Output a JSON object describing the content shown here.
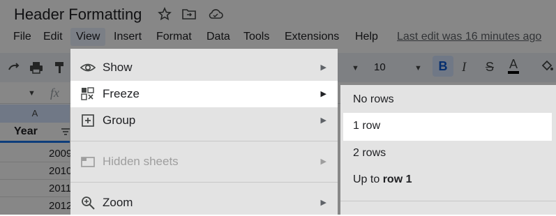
{
  "document": {
    "title": "Header Formatting"
  },
  "menubar": {
    "items": [
      "File",
      "Edit",
      "View",
      "Insert",
      "Format",
      "Data",
      "Tools",
      "Extensions",
      "Help"
    ],
    "last_edit": "Last edit was 16 minutes ago"
  },
  "toolbar": {
    "font_size": "10",
    "bold": "B",
    "italic": "I",
    "strike": "S",
    "text_color": "A"
  },
  "formula_bar": {
    "fx": "fx"
  },
  "sheet": {
    "column_header": "A",
    "header_cell": "Year",
    "values": [
      "2009",
      "2010",
      "2011",
      "2012"
    ]
  },
  "view_menu": {
    "items": [
      {
        "label": "Show",
        "icon": "eye-icon",
        "has_submenu": true
      },
      {
        "label": "Freeze",
        "icon": "freeze-grid-icon",
        "has_submenu": true
      },
      {
        "label": "Group",
        "icon": "plus-box-icon",
        "has_submenu": true
      },
      {
        "label": "Hidden sheets",
        "icon": "hidden-sheet-icon",
        "has_submenu": true,
        "disabled": true
      },
      {
        "label": "Zoom",
        "icon": "zoom-icon",
        "has_submenu": true
      }
    ]
  },
  "freeze_submenu": {
    "items": [
      {
        "label": "No rows"
      },
      {
        "label": "1 row",
        "highlighted": true
      },
      {
        "label": "2 rows"
      },
      {
        "label_prefix": "Up to ",
        "label_bold": "row 1"
      }
    ]
  },
  "colors": {
    "highlight": "#ffffff",
    "menu_background": "#e3e3e3",
    "selection_blue": "#1a73e8",
    "bold_active": "#d3e3fd"
  }
}
